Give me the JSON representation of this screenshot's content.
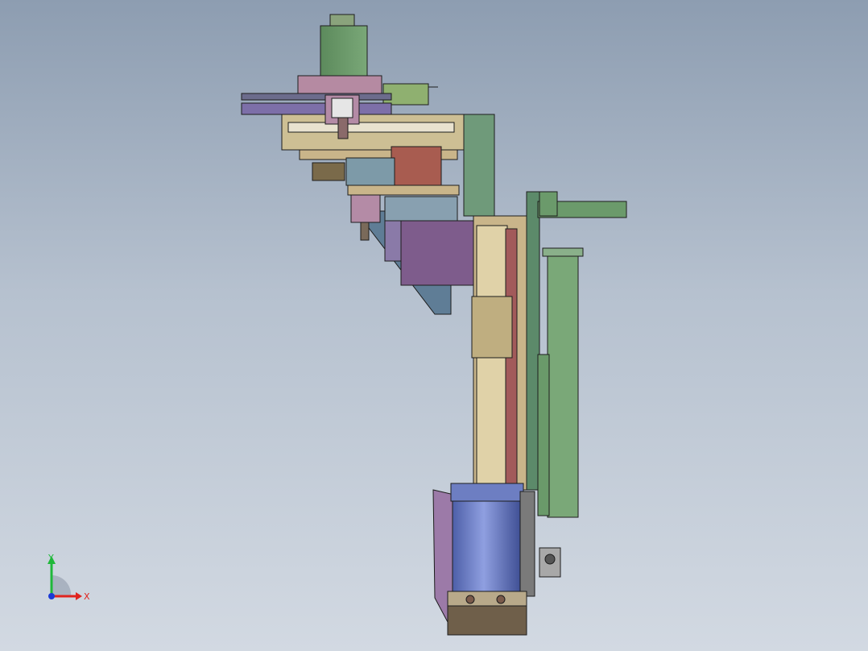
{
  "viewport": {
    "background_top": "#8d9db1",
    "background_bottom": "#d2d9e2"
  },
  "triad": {
    "x_label": "X",
    "y_label": "Y",
    "x_color": "#e0241f",
    "y_color": "#1fb83a",
    "z_color": "#1a3ad6"
  },
  "model": {
    "parts": [
      "motor-top",
      "linear-slide-x",
      "linear-slide-y",
      "vertical-column",
      "servo-motor",
      "base-block",
      "side-bracket",
      "right-rail"
    ]
  }
}
